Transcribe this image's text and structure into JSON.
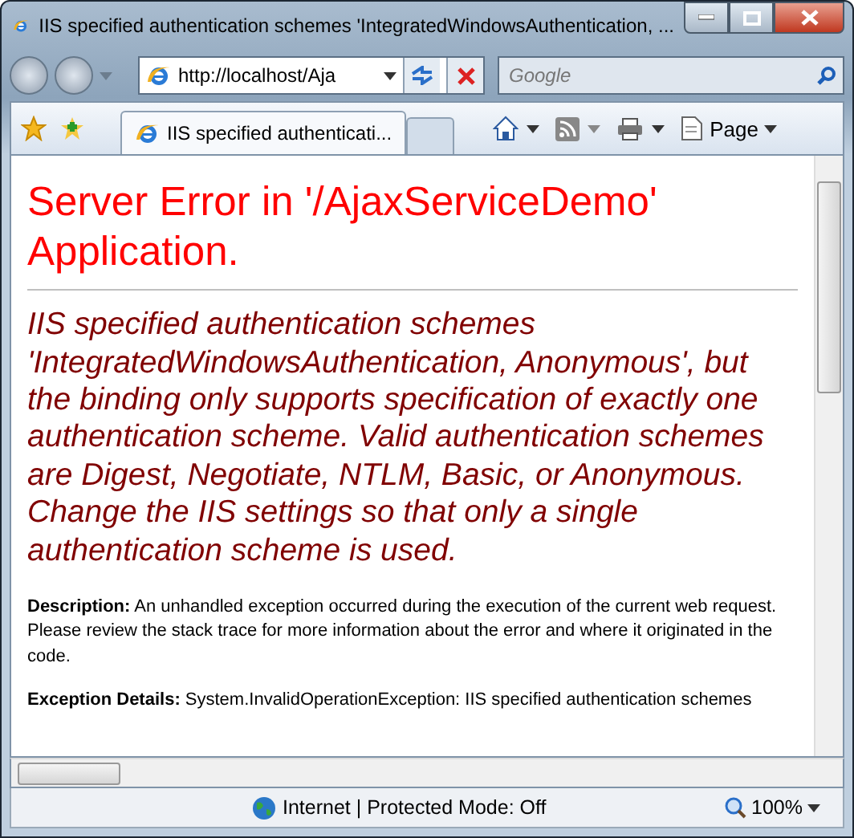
{
  "window": {
    "title": "IIS specified authentication schemes 'IntegratedWindowsAuthentication, ..."
  },
  "address_bar": {
    "value": "http://localhost/Aja"
  },
  "search": {
    "placeholder": "Google"
  },
  "tabs": [
    {
      "label": "IIS specified authenticati...",
      "selected": true
    }
  ],
  "command_bar": {
    "page_menu": "Page"
  },
  "page": {
    "heading": "Server Error in '/AjaxServiceDemo' Application.",
    "message": "IIS specified authentication schemes 'IntegratedWindowsAuthentication, Anonymous', but the binding only supports specification of exactly one authentication scheme. Valid authentication schemes are Digest, Negotiate, NTLM, Basic, or Anonymous. Change the IIS settings so that only a single authentication scheme is used.",
    "sections": [
      {
        "text": "**Description:** An unhandled exception occurred during the execution of the current web request. Please review the stack trace for more information about the error and where it originated in the code."
      },
      {
        "text": "**Exception Details:** System.InvalidOperationException: IIS specified authentication schemes"
      }
    ]
  },
  "status_bar": {
    "zone": "Internet | Protected Mode: Off",
    "zoom": "100%"
  }
}
